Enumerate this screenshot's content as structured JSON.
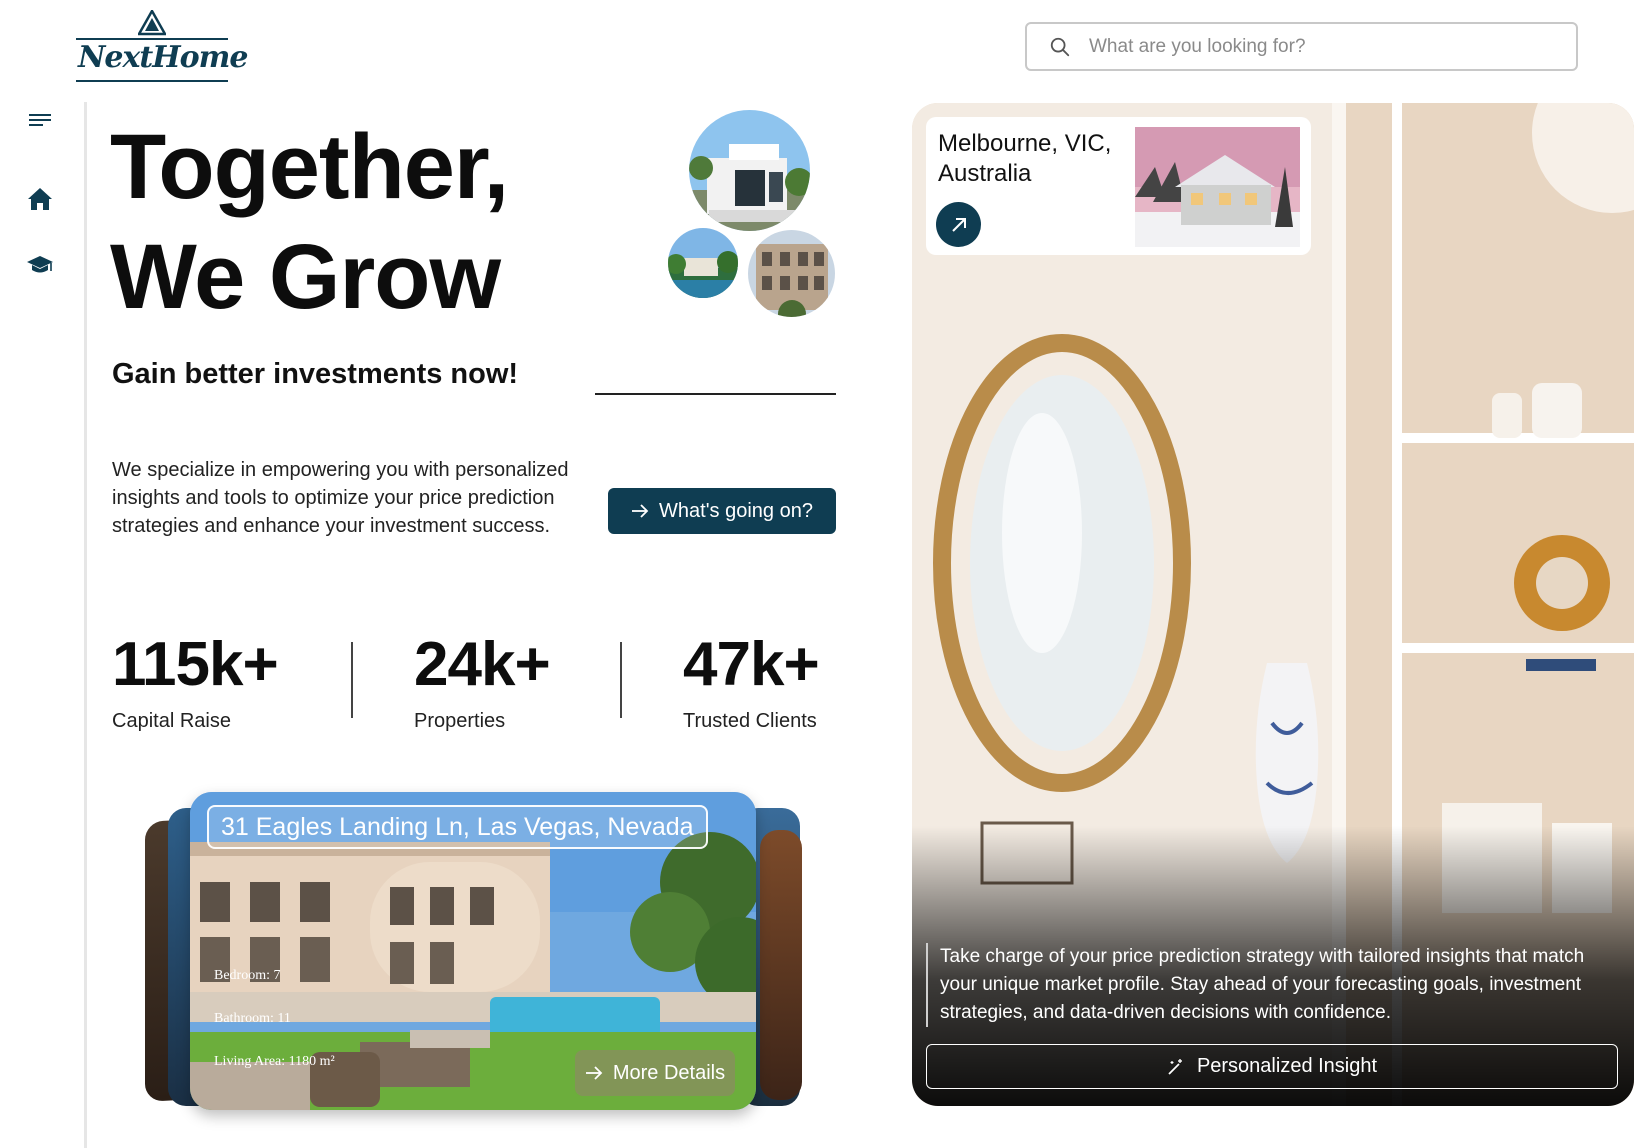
{
  "brand": {
    "name": "NextHome",
    "color_primary": "#0f3d52"
  },
  "search": {
    "placeholder": "What are you looking for?",
    "icon": "search-icon"
  },
  "sidebar": {
    "items": [
      {
        "name": "menu",
        "icon": "hamburger-menu-icon"
      },
      {
        "name": "home",
        "icon": "home-icon"
      },
      {
        "name": "education",
        "icon": "graduation-cap-icon"
      }
    ]
  },
  "hero": {
    "title_line1": "Together,",
    "title_line2": "We Grow",
    "subtitle": "Gain better investments now!",
    "description": "We specialize in empowering you with personalized insights and tools to optimize your price prediction strategies and enhance your investment success.",
    "cta_label": "What's going on?"
  },
  "stats": [
    {
      "value": "115k+",
      "label": "Capital Raise"
    },
    {
      "value": "24k+",
      "label": "Properties"
    },
    {
      "value": "47k+",
      "label": "Trusted Clients"
    }
  ],
  "property_card": {
    "address": "31 Eagles Landing Ln, Las Vegas, Nevada",
    "bedroom": "Bedroom: 7",
    "bathroom": "Bathroom: 11",
    "living_area": "Living Area: 1180 m²",
    "more_label": "More Details"
  },
  "feature": {
    "location": "Melbourne, VIC, Australia",
    "text": "Take charge of your price prediction strategy with tailored insights that match your unique market profile. Stay ahead of your forecasting goals, investment strategies, and data-driven decisions with confidence.",
    "insight_label": "Personalized Insight"
  }
}
